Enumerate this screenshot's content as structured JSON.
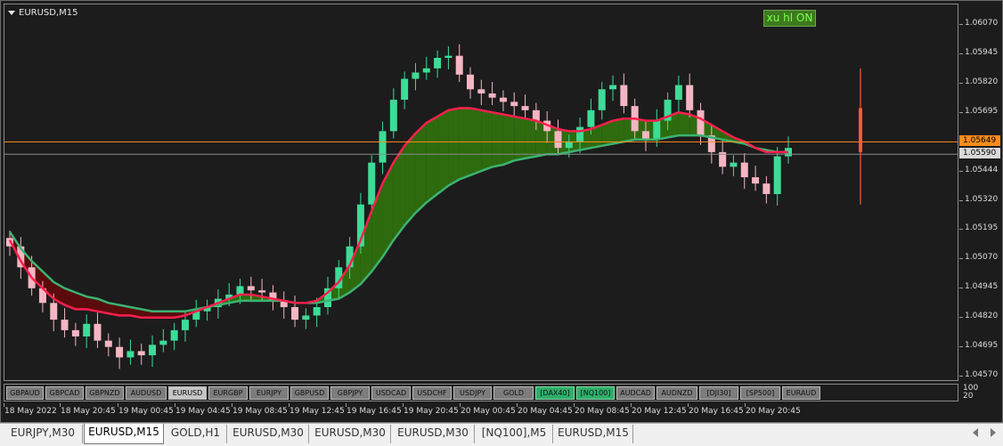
{
  "chart": {
    "symbol_title": "EURUSD,M15",
    "xuhl_button": "xu hl ON",
    "price_ticks": [
      "1.06070",
      "1.05945",
      "1.05820",
      "1.05695",
      "1.05570",
      "1.05444",
      "1.05320",
      "1.05195",
      "1.05070",
      "1.04945",
      "1.04820",
      "1.04695",
      "1.04570"
    ],
    "ask_price": "1.05649",
    "bid_price": "1.05590",
    "indicator_scale": [
      "100",
      "20"
    ],
    "time_labels": [
      "18 May 2022",
      "18 May 20:45",
      "19 May 00:45",
      "19 May 04:45",
      "19 May 08:45",
      "19 May 12:45",
      "19 May 16:45",
      "19 May 20:45",
      "20 May 00:45",
      "20 May 04:45",
      "20 May 08:45",
      "20 May 12:45",
      "20 May 16:45",
      "20 May 20:45"
    ],
    "colors": {
      "bull_candle": "#3ddc97",
      "bear_candle": "#f4b6c2",
      "fast_ma": "#ff1f4d",
      "slow_ma": "#3cb371",
      "bull_cloud": "#2e6b0f",
      "bear_cloud": "#5a0c0c",
      "ask_line": "#ff8c1a",
      "bid_line": "#8a8a8a",
      "volume_bar": "#ff5a36"
    }
  },
  "chart_data": {
    "type": "candlestick",
    "symbol": "EURUSD",
    "timeframe": "M15",
    "ylim": [
      1.0452,
      1.0622
    ],
    "close_series": [
      1.0515,
      1.0505,
      1.0495,
      1.0488,
      1.048,
      1.0475,
      1.0472,
      1.0478,
      1.047,
      1.0467,
      1.0462,
      1.0465,
      1.0463,
      1.0468,
      1.047,
      1.0475,
      1.048,
      1.0484,
      1.0486,
      1.049,
      1.0492,
      1.0496,
      1.0494,
      1.0493,
      1.0489,
      1.0486,
      1.048,
      1.0482,
      1.0486,
      1.0495,
      1.0505,
      1.0515,
      1.0535,
      1.0555,
      1.057,
      1.0585,
      1.0595,
      1.0598,
      1.06,
      1.0605,
      1.0606,
      1.0597,
      1.059,
      1.0588,
      1.0586,
      1.0584,
      1.0582,
      1.058,
      1.0575,
      1.057,
      1.0562,
      1.0565,
      1.0572,
      1.058,
      1.059,
      1.0592,
      1.0582,
      1.057,
      1.0566,
      1.0575,
      1.0585,
      1.0592,
      1.058,
      1.0568,
      1.056,
      1.0553,
      1.0555,
      1.0548,
      1.0545,
      1.054,
      1.0558,
      1.0562
    ],
    "fast_ma": [
      1.0518,
      1.0508,
      1.05,
      1.0495,
      1.049,
      1.0487,
      1.0485,
      1.0485,
      1.0484,
      1.0483,
      1.0482,
      1.0482,
      1.0481,
      1.0481,
      1.0481,
      1.0481,
      1.0482,
      1.0484,
      1.0486,
      1.0488,
      1.049,
      1.0492,
      1.0492,
      1.0491,
      1.049,
      1.0489,
      1.0488,
      1.0488,
      1.0489,
      1.0493,
      1.0498,
      1.0506,
      1.0518,
      1.0532,
      1.0545,
      1.0555,
      1.0563,
      1.0569,
      1.0574,
      1.0577,
      1.058,
      1.0581,
      1.0581,
      1.058,
      1.0579,
      1.0578,
      1.0577,
      1.0576,
      1.0575,
      1.0573,
      1.0571,
      1.057,
      1.057,
      1.0571,
      1.0573,
      1.0575,
      1.0576,
      1.0576,
      1.0575,
      1.0575,
      1.0577,
      1.0579,
      1.0578,
      1.0576,
      1.0573,
      1.057,
      1.0567,
      1.0565,
      1.0562,
      1.056,
      1.056,
      1.056
    ],
    "slow_ma": [
      1.0522,
      1.0514,
      1.0508,
      1.0503,
      1.0498,
      1.0495,
      1.0493,
      1.0491,
      1.049,
      1.0488,
      1.0487,
      1.0486,
      1.0485,
      1.0484,
      1.0484,
      1.0484,
      1.0484,
      1.0485,
      1.0486,
      1.0487,
      1.0488,
      1.0489,
      1.0489,
      1.0489,
      1.0489,
      1.0489,
      1.0488,
      1.0488,
      1.0488,
      1.0489,
      1.049,
      1.0493,
      1.0497,
      1.0503,
      1.051,
      1.0518,
      1.0525,
      1.0531,
      1.0536,
      1.054,
      1.0544,
      1.0547,
      1.0549,
      1.0551,
      1.0553,
      1.0554,
      1.0556,
      1.0557,
      1.0558,
      1.0559,
      1.0559,
      1.056,
      1.0561,
      1.0562,
      1.0563,
      1.0564,
      1.0565,
      1.0566,
      1.0566,
      1.0566,
      1.0567,
      1.0568,
      1.0568,
      1.0568,
      1.0567,
      1.0566,
      1.0565,
      1.0564,
      1.0562,
      1.0561,
      1.056,
      1.056
    ],
    "volume_bar": {
      "low": 1.0535,
      "high": 1.06,
      "body_low": 1.056,
      "body_high": 1.0581
    }
  },
  "symbol_buttons": [
    {
      "label": "GBPAUD",
      "style": "gray"
    },
    {
      "label": "GBPCAD",
      "style": "gray"
    },
    {
      "label": "GBPNZD",
      "style": "gray"
    },
    {
      "label": "AUDUSD",
      "style": "gray"
    },
    {
      "label": "EURUSD",
      "style": "active"
    },
    {
      "label": "EURGBP",
      "style": "gray"
    },
    {
      "label": "EURJPY",
      "style": "gray"
    },
    {
      "label": "GBPUSD",
      "style": "gray"
    },
    {
      "label": "GBPJPY",
      "style": "gray"
    },
    {
      "label": "USDCAD",
      "style": "gray"
    },
    {
      "label": "USDCHF",
      "style": "gray"
    },
    {
      "label": "USDJPY",
      "style": "gray"
    },
    {
      "label": "GOLD",
      "style": "gray"
    },
    {
      "label": "[DAX40]",
      "style": "green"
    },
    {
      "label": "[NQ100]",
      "style": "green"
    },
    {
      "label": "AUDCAD",
      "style": "gray"
    },
    {
      "label": "AUDNZD",
      "style": "gray"
    },
    {
      "label": "[DJI30]",
      "style": "gray"
    },
    {
      "label": "[SP500]",
      "style": "gray"
    },
    {
      "label": "EURAUD",
      "style": "gray"
    }
  ],
  "tabs": [
    {
      "label": "EURJPY,M30",
      "active": false
    },
    {
      "label": "EURUSD,M15",
      "active": true
    },
    {
      "label": "GOLD,H1",
      "active": false
    },
    {
      "label": "EURUSD,M30",
      "active": false
    },
    {
      "label": "EURUSD,M30",
      "active": false
    },
    {
      "label": "EURUSD,M30",
      "active": false
    },
    {
      "label": "[NQ100],M5",
      "active": false
    },
    {
      "label": "EURUSD,M15",
      "active": false
    }
  ]
}
